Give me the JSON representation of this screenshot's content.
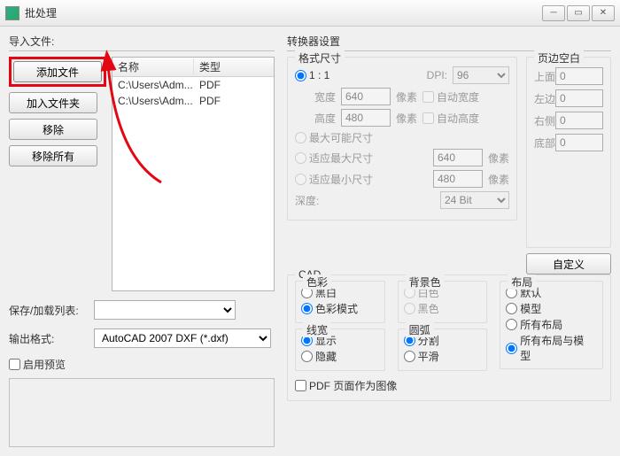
{
  "window": {
    "title": "批处理"
  },
  "left": {
    "import_label": "导入文件:",
    "buttons": {
      "add_file": "添加文件",
      "add_folder": "加入文件夹",
      "remove": "移除",
      "remove_all": "移除所有"
    },
    "columns": {
      "name": "名称",
      "type": "类型"
    },
    "rows": [
      {
        "name": "C:\\Users\\Adm...",
        "type": "PDF"
      },
      {
        "name": "C:\\Users\\Adm...",
        "type": "PDF"
      }
    ],
    "save_list_label": "保存/加载列表:",
    "output_format_label": "输出格式:",
    "output_format_value": "AutoCAD 2007 DXF (*.dxf)",
    "enable_preview": "启用预览"
  },
  "right": {
    "converter_label": "转换器设置",
    "format": {
      "title": "格式尺寸",
      "one_to_one": "1 : 1",
      "dpi_label": "DPI:",
      "dpi_value": "96",
      "width_label": "宽度",
      "width_value": "640",
      "px1": "像素",
      "auto_width": "自动宽度",
      "height_label": "高度",
      "height_value": "480",
      "px2": "像素",
      "auto_height": "自动高度",
      "max_possible": "最大可能尺寸",
      "fit_max": "适应最大尺寸",
      "fit_max_value": "640",
      "px3": "像素",
      "fit_min": "适应最小尺寸",
      "fit_min_value": "480",
      "px4": "像素",
      "depth_label": "深度:",
      "depth_value": "24 Bit"
    },
    "margins": {
      "title": "页边空白",
      "top": "上面",
      "left": "左边",
      "right": "右侧",
      "bottom": "底部",
      "top_v": "0",
      "left_v": "0",
      "right_v": "0",
      "bottom_v": "0",
      "custom": "自定义"
    },
    "cad": {
      "title": "CAD",
      "color": {
        "title": "色彩",
        "bw": "黑白",
        "mode": "色彩模式"
      },
      "bg": {
        "title": "背景色",
        "white": "白色",
        "black": "黑色"
      },
      "layout": {
        "title": "布局",
        "def": "默认",
        "model": "模型",
        "all": "所有布局",
        "all_model": "所有布局与模型"
      },
      "linew": {
        "title": "线宽",
        "show": "显示",
        "hide": "隐藏"
      },
      "arc": {
        "title": "圆弧",
        "split": "分割",
        "smooth": "平滑"
      },
      "pdf_as_image": "PDF 页面作为图像"
    }
  }
}
